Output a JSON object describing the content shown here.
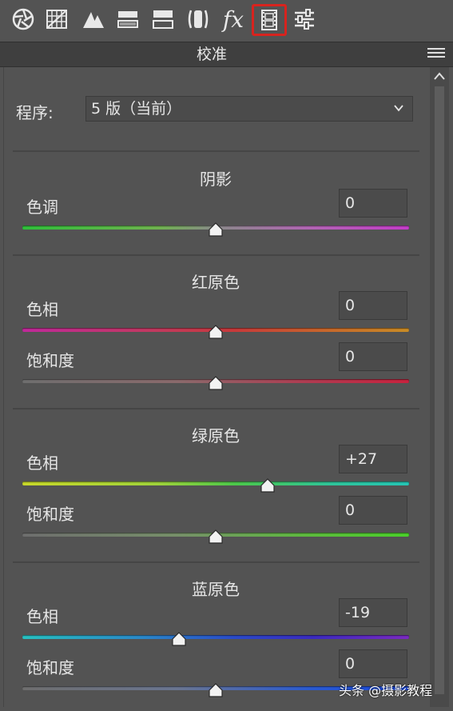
{
  "toolbar": {
    "icons": [
      "aperture-icon",
      "tone-curve-grid-icon",
      "detail-triangles-icon",
      "hsl-bars-icon",
      "split-toning-icon",
      "lens-corrections-icon",
      "fx-icon",
      "camera-calibration-icon",
      "presets-sliders-icon"
    ],
    "fx_label": "fx",
    "active_icon": "camera-calibration-icon"
  },
  "panel": {
    "title": "校准",
    "process_label": "程序:",
    "process_value": "5 版（当前）"
  },
  "sections": [
    {
      "title": "阴影",
      "rows": [
        {
          "label": "色调",
          "value": "0",
          "fraction": 0.5,
          "gradient": "linear-gradient(90deg,#2fbf3a,#6fb34f 35%,#8a8a8a 50%,#b364b5 75%,#c43cc8)"
        }
      ]
    },
    {
      "title": "红原色",
      "rows": [
        {
          "label": "色相",
          "value": "0",
          "fraction": 0.5,
          "gradient": "linear-gradient(90deg,#c0299a,#c23a5e 35%,#c83a3a 55%,#c86a2a 80%,#c98c26)"
        },
        {
          "label": "饱和度",
          "value": "0",
          "fraction": 0.5,
          "gradient": "linear-gradient(90deg,#6e6e6e,#8a6a6c 40%,#b03a50 75%,#c8223e)"
        }
      ]
    },
    {
      "title": "绿原色",
      "rows": [
        {
          "label": "色相",
          "value": "+27",
          "fraction": 0.635,
          "gradient": "linear-gradient(90deg,#c8d82a,#9fd23a 35%,#4cc84a 55%,#2fc49a 80%,#25c4b4)"
        },
        {
          "label": "饱和度",
          "value": "0",
          "fraction": 0.5,
          "gradient": "linear-gradient(90deg,#6e6e6e,#77906a 40%,#5cbc3c 75%,#4ad02a)"
        }
      ]
    },
    {
      "title": "蓝原色",
      "rows": [
        {
          "label": "色相",
          "value": "-19",
          "fraction": 0.405,
          "gradient": "linear-gradient(90deg,#28c0c0,#2a8ac8 30%,#2a4ac8 55%,#3a2ac0 75%,#7a2ac0)"
        },
        {
          "label": "饱和度",
          "value": "0",
          "fraction": 0.5,
          "gradient": "linear-gradient(90deg,#6e6e6e,#6a7590 40%,#2a5ad0 75%,#1a48e0)"
        }
      ]
    }
  ],
  "watermark": "头条 @摄影教程"
}
